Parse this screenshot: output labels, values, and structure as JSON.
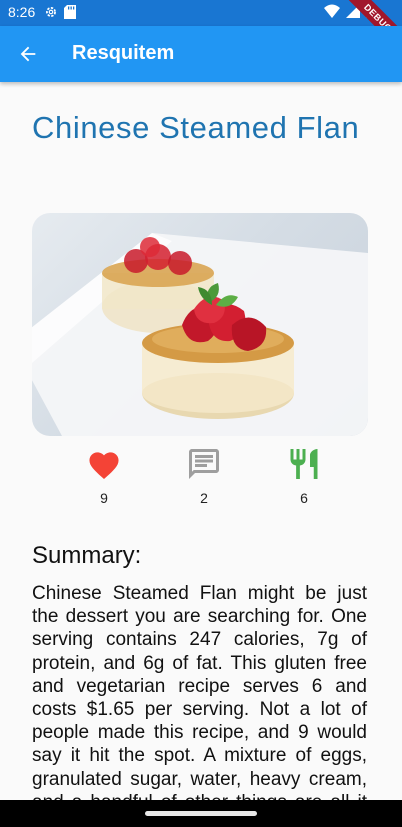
{
  "status_bar": {
    "time": "8:26",
    "icons": [
      "settings-icon",
      "sd-card-icon",
      "wifi-icon",
      "signal-icon",
      "battery-icon"
    ]
  },
  "debug_banner": "DEBUG",
  "app_bar": {
    "title": "Resquitem",
    "back_icon": "arrow-back-icon",
    "background": "#2196f3"
  },
  "recipe": {
    "title": "Chinese Steamed Flan",
    "title_color": "#1f74b0"
  },
  "stats": [
    {
      "icon": "heart-icon",
      "value": "9",
      "color": "#f44336"
    },
    {
      "icon": "comment-icon",
      "value": "2",
      "color": "#9e9e9e"
    },
    {
      "icon": "utensils-icon",
      "value": "6",
      "color": "#4caf50"
    }
  ],
  "summary": {
    "heading": "Summary:",
    "text": "Chinese Steamed Flan might be just the dessert you are searching for. One serving contains 247 calories, 7g of protein, and 6g of fat. This gluten free and vegetarian recipe serves 6 and costs $1.65 per serving. Not a lot of people made this recipe, and 9 would say it hit the spot. A mixture of eggs, granulated sugar, water, heavy cream, and a handful of other things are all it takes to make this recipe so delicious."
  }
}
